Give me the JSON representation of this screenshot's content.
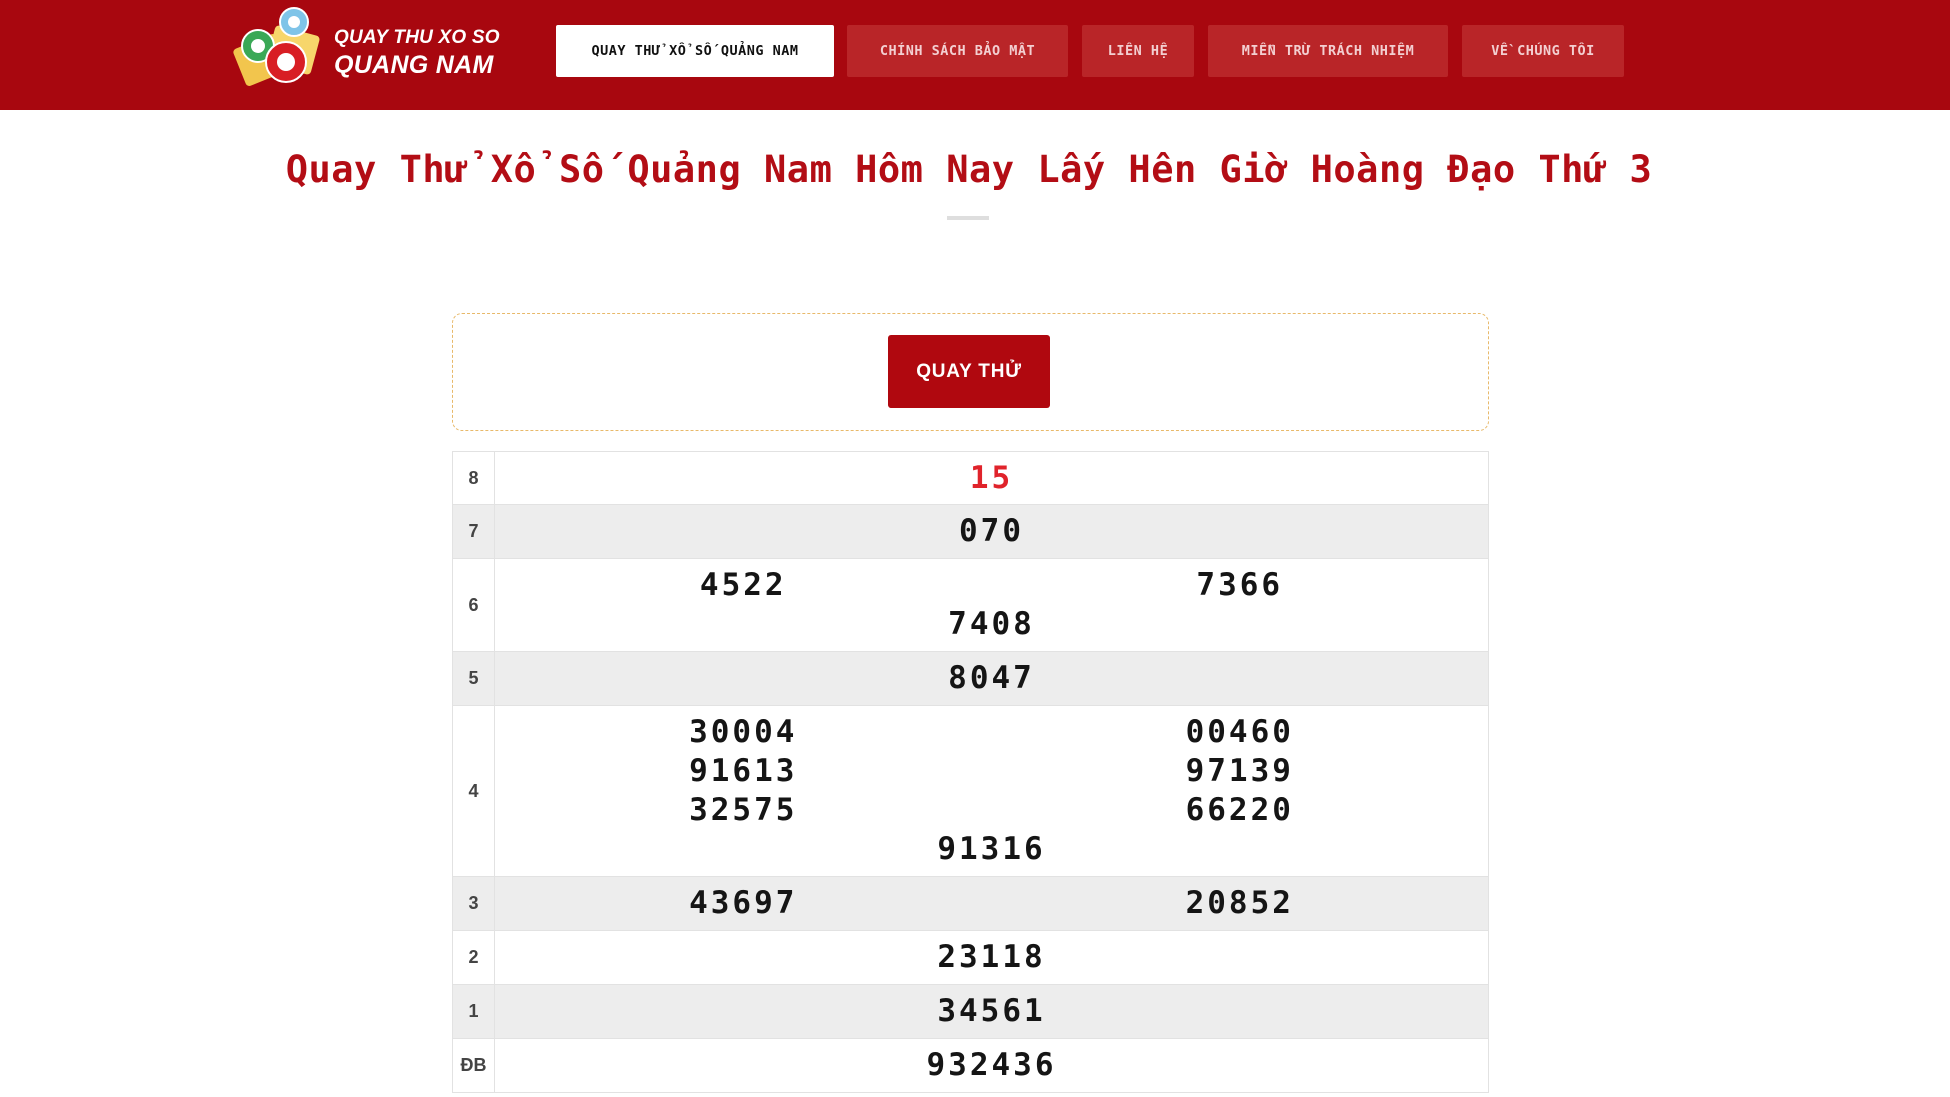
{
  "header": {
    "logo": {
      "line1": "QUAY THU XO SO",
      "line2": "QUANG NAM"
    },
    "nav": [
      {
        "label": "QUAY THỬ XỔ SỐ QUẢNG NAM",
        "active": true
      },
      {
        "label": "CHÍNH SÁCH BẢO MẬT",
        "active": false
      },
      {
        "label": "LIÊN HỆ",
        "active": false
      },
      {
        "label": "MIỄN TRỪ TRÁCH NHIỆM",
        "active": false
      },
      {
        "label": "VỀ CHÚNG TÔI",
        "active": false
      }
    ]
  },
  "page_title": "Quay Thử Xổ Số Quảng Nam Hôm Nay Lấy Hên Giờ Hoàng Đạo Thứ 3",
  "spin_button": "QUAY THỬ",
  "results": [
    {
      "prize": "8",
      "numbers": [
        "15"
      ]
    },
    {
      "prize": "7",
      "numbers": [
        "070"
      ]
    },
    {
      "prize": "6",
      "numbers": [
        "4522",
        "7366",
        "7408"
      ]
    },
    {
      "prize": "5",
      "numbers": [
        "8047"
      ]
    },
    {
      "prize": "4",
      "numbers": [
        "30004",
        "00460",
        "91613",
        "97139",
        "32575",
        "66220",
        "91316"
      ]
    },
    {
      "prize": "3",
      "numbers": [
        "43697",
        "20852"
      ]
    },
    {
      "prize": "2",
      "numbers": [
        "23118"
      ]
    },
    {
      "prize": "1",
      "numbers": [
        "34561"
      ]
    },
    {
      "prize": "ĐB",
      "numbers": [
        "932436"
      ]
    }
  ],
  "colors": {
    "header_bg": "#a8070f",
    "nav_bg": "#b92528",
    "title": "#b30d15",
    "button": "#b0080f",
    "eighth_prize": "#e0232b"
  }
}
